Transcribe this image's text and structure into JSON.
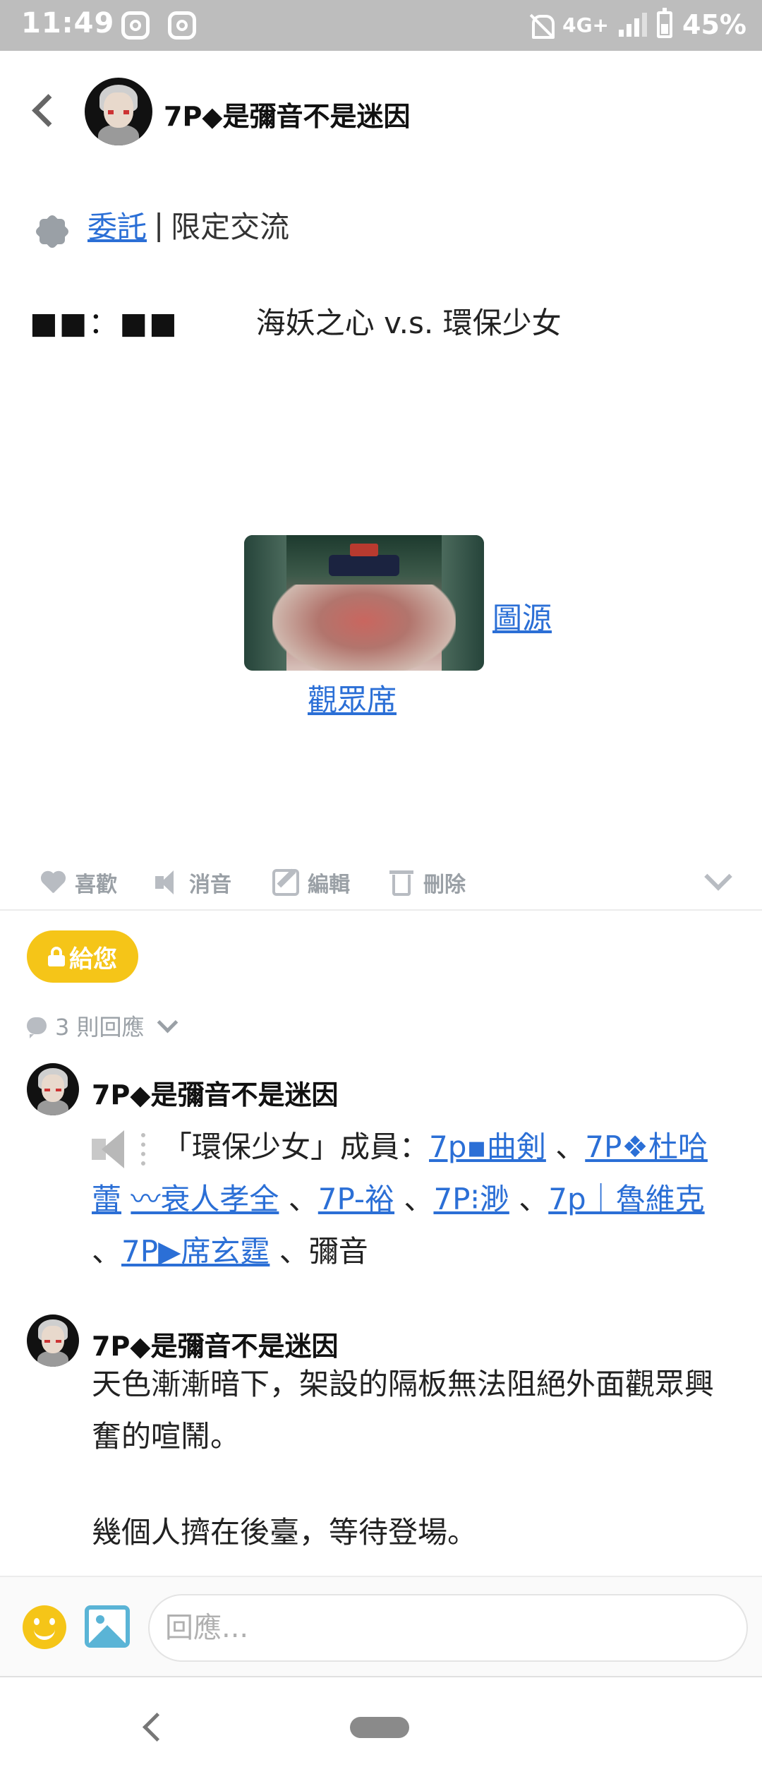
{
  "status_bar": {
    "time": "11:49",
    "network": "4G+",
    "battery": "45%"
  },
  "header": {
    "title": "7P◆是彌音不是迷因"
  },
  "post": {
    "tag_link": "委託",
    "tag_separator": "|",
    "tag_text": "限定交流",
    "redacted": "■■：■■",
    "match_title": "海妖之心 v.s. 環保少女",
    "source_link": "圖源",
    "caption_link": "觀眾席"
  },
  "actions": {
    "like": "喜歡",
    "mute": "消音",
    "edit": "編輯",
    "delete": "刪除"
  },
  "badge": {
    "label": "給您"
  },
  "replies": {
    "count_label": "3 則回應"
  },
  "comments": [
    {
      "author": "7P◆是彌音不是迷因",
      "intro": "「環保少女」成員：",
      "members": [
        "7p▪曲剣",
        "7P❖杜哈蕾",
        "〰衰人孝全",
        "7P-裕",
        "7P⁝渺",
        "7p｜魯維克",
        "7P▶席玄霆"
      ],
      "last_member": "彌音",
      "separator": "、"
    },
    {
      "author": "7P◆是彌音不是迷因",
      "paragraph1": "天色漸漸暗下，架設的隔板無法阻絕外面觀眾興奮的喧鬧。",
      "paragraph2": "幾個人擠在後臺，等待登場。"
    }
  ],
  "reply_bar": {
    "placeholder": "回應..."
  }
}
